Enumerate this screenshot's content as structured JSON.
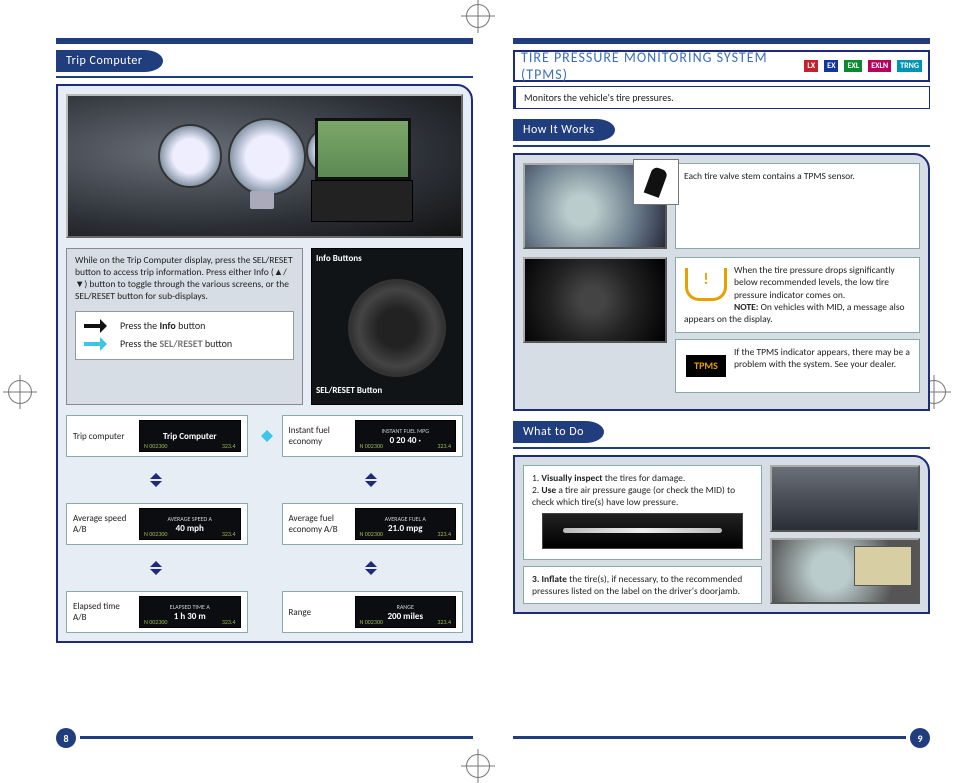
{
  "left": {
    "section_title": "Trip Computer",
    "info_paragraph": "While on the Trip Computer display, press the SEL/RESET button to access trip information. Press either Info (▲/▼) button to toggle through the various screens, or the SEL/RESET button for sub-displays.",
    "callout_info": "Info Buttons",
    "callout_sel": "SEL/RESET Button",
    "press_info_a": "Press the",
    "press_info_b": "Info",
    "press_info_c": "button",
    "press_sel_a": "Press the",
    "press_sel_b": "SEL/RESET",
    "press_sel_c": "button",
    "cells": {
      "trip": {
        "label": "Trip computer",
        "lcd_title": "Trip Computer",
        "lcd_big": "",
        "n": "N 002300",
        "v": "323.4"
      },
      "instant": {
        "label": "Instant fuel economy",
        "lcd_title": "INSTANT FUEL  MPG",
        "lcd_big": "0   20   40 ·",
        "n": "N 002300",
        "v": "323.4"
      },
      "avgspeed": {
        "label": "Average speed A/B",
        "lcd_title": "AVERAGE SPEED A",
        "lcd_big": "40 mph",
        "n": "N 002300",
        "v": "323.4"
      },
      "avgfuel": {
        "label": "Average fuel economy A/B",
        "lcd_title": "AVERAGE FUEL A",
        "lcd_big": "21.0 mpg",
        "n": "N 002300",
        "v": "323.4"
      },
      "elapsed": {
        "label": "Elapsed time A/B",
        "lcd_title": "ELAPSED TIME A",
        "lcd_big": "1 h 30 m",
        "n": "N 002300",
        "v": "323.4"
      },
      "range": {
        "label": "Range",
        "lcd_title": "RANGE",
        "lcd_big": "200 miles",
        "n": "N 002300",
        "v": "323.4"
      }
    },
    "page_number": "8"
  },
  "right": {
    "title": "TIRE PRESSURE MONITORING SYSTEM (TPMS)",
    "trims": {
      "lx": "LX",
      "ex": "EX",
      "exl": "EXL",
      "exln": "EXLN",
      "trng": "TRNG"
    },
    "monitors_text": "Monitors the vehicle's tire pressures.",
    "how_it_works_title": "How It Works",
    "sensor_text": "Each tire valve stem contains a TPMS sensor.",
    "drops_text": "When the tire pressure drops significantly below recommended levels, the low tire pressure indicator comes on.",
    "note_label": "NOTE:",
    "note_text": "On vehicles with MID, a message also appears on the display.",
    "indicator_text": "If the TPMS indicator appears, there may be a problem with the system. See your dealer.",
    "tpms_badge": "TPMS",
    "what_to_do_title": "What to Do",
    "step1_a": "1.",
    "step1_b": "Visually inspect",
    "step1_c": "the tires for damage.",
    "step2_a": "2.",
    "step2_b": "Use",
    "step2_c": "a tire air pressure gauge (or check the MID) to check which tire(s) have low pressure.",
    "step3_a": "3.",
    "step3_b": "Inflate",
    "step3_c": "the tire(s), if necessary, to the recommended pressures listed on the label on the driver's doorjamb.",
    "page_number": "9"
  }
}
